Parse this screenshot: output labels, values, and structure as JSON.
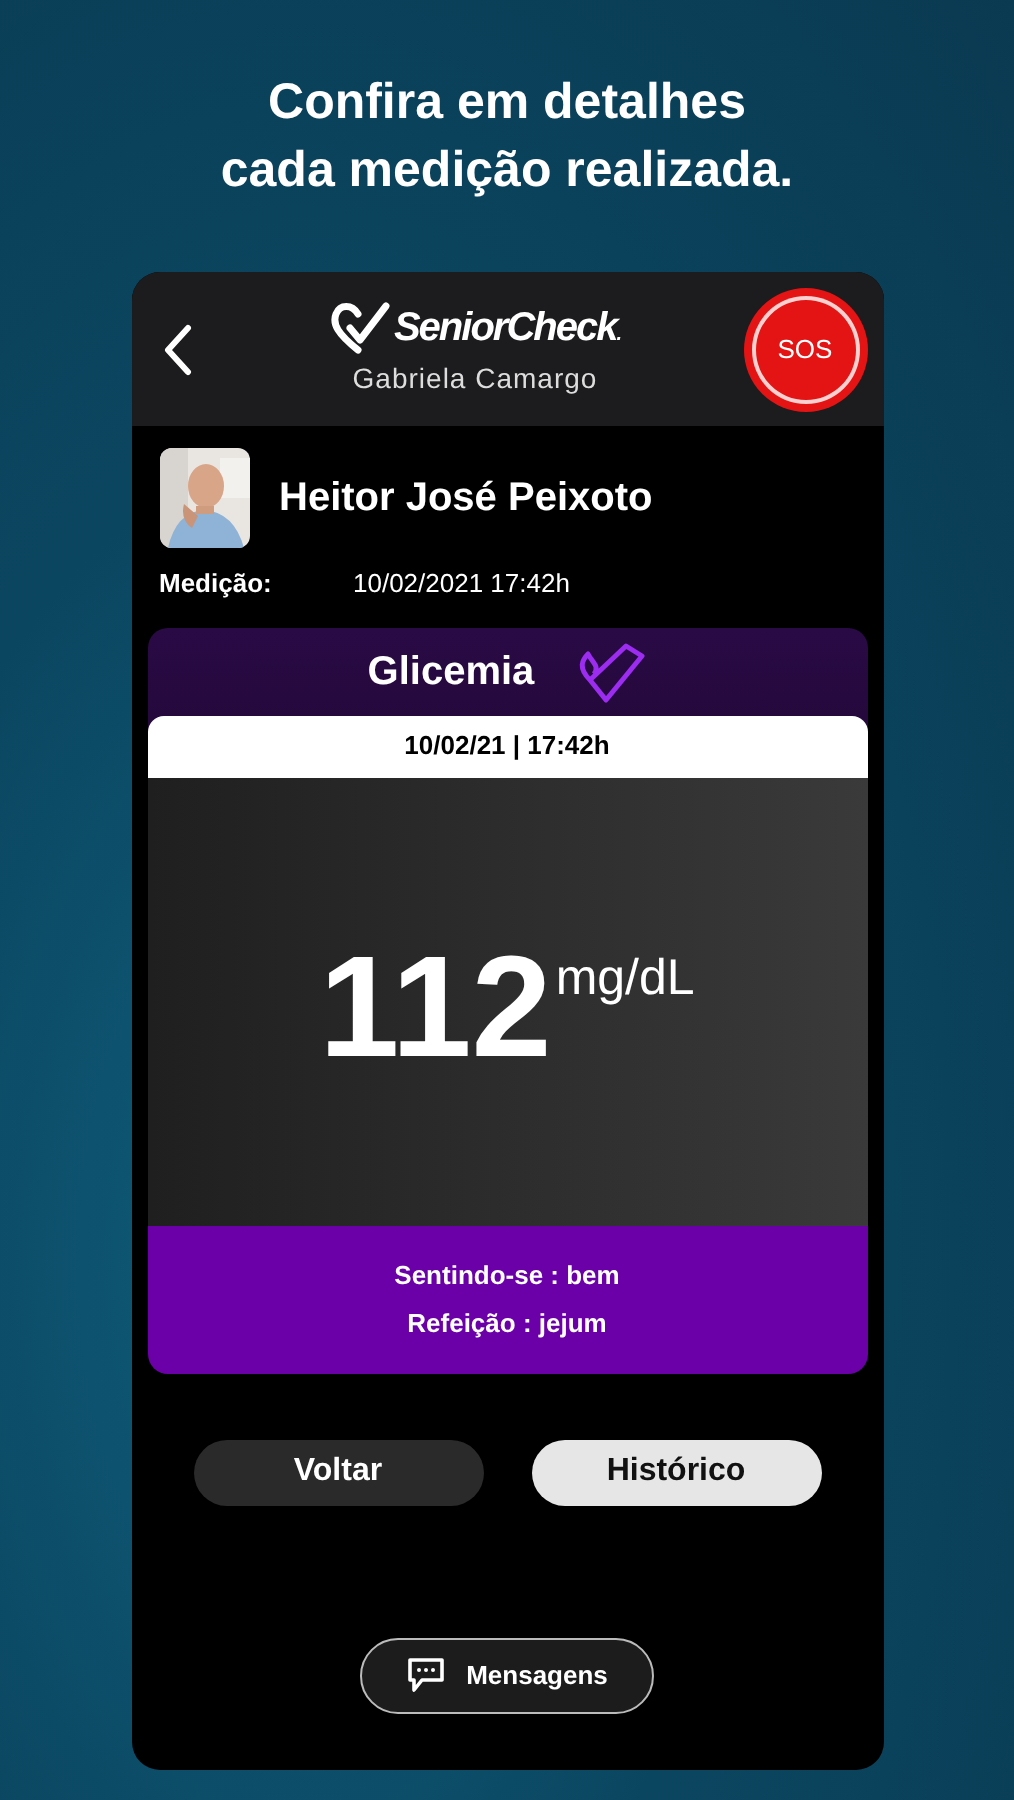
{
  "headline": "Confira em detalhes\ncada medição realizada.",
  "header": {
    "logo": "SeniorCheck",
    "logo_mark": ".",
    "subtitle": "Gabriela Camargo",
    "sos": "SOS"
  },
  "patient": {
    "name": "Heitor José Peixoto"
  },
  "measurement": {
    "label": "Medição:",
    "value": "10/02/2021 17:42h"
  },
  "card": {
    "title": "Glicemia",
    "datetime": "10/02/21 | 17:42h",
    "value": "112",
    "unit": "mg/dL",
    "notes": [
      "Sentindo-se : bem",
      "Refeição : jejum"
    ]
  },
  "buttons": [
    {
      "label": "Voltar",
      "kind": "dark"
    },
    {
      "label": "Histórico",
      "kind": "light"
    }
  ],
  "messages_button": "Mensagens"
}
